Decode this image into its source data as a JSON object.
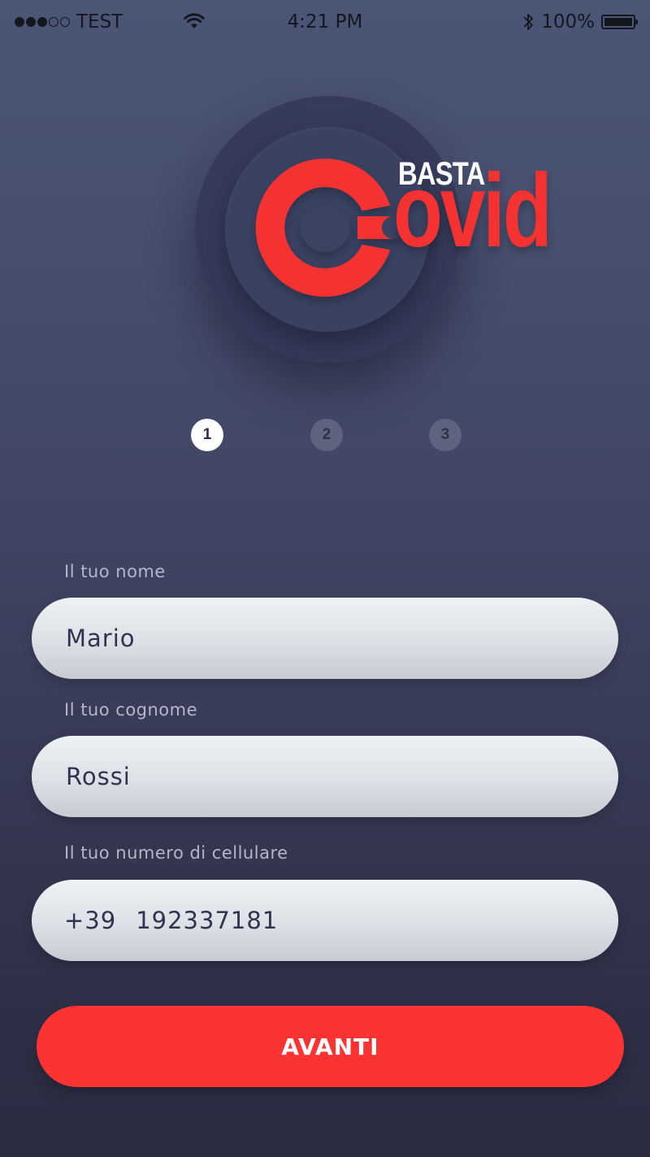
{
  "status_bar": {
    "carrier": "TEST",
    "time": "4:21 PM",
    "battery": "100%",
    "signal_bars_filled": 3,
    "signal_bars_total": 5
  },
  "logo": {
    "basta": "BASTA",
    "ovid": "ovid",
    "brand_color": "#f43232"
  },
  "steps": [
    {
      "label": "1",
      "active": true
    },
    {
      "label": "2",
      "active": false
    },
    {
      "label": "3",
      "active": false
    }
  ],
  "form": {
    "first_name": {
      "label": "Il tuo nome",
      "value": "Mario"
    },
    "last_name": {
      "label": "Il tuo cognome",
      "value": "Rossi"
    },
    "phone": {
      "label": "Il tuo numero di cellulare",
      "prefix": "+39",
      "value": "192337181"
    }
  },
  "submit_button": {
    "label": "AVANTI",
    "color": "#fb3333"
  }
}
